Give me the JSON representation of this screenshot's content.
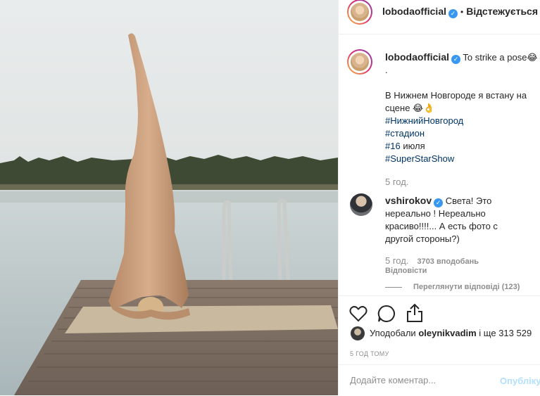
{
  "header": {
    "username": "lobodaofficial",
    "dot": "•",
    "follow_label": "Відстежується"
  },
  "caption": {
    "username": "lobodaofficial",
    "text_line1": "To strike a pose😂",
    "text_line2": ".",
    "body": "В Нижнем Новгороде я встану на сцене 😂👌",
    "hashtags": [
      "#НижнийНовгород",
      "#стадион"
    ],
    "date_hash": "#16",
    "date_rest": " июля",
    "hashtag_last": "#SuperStarShow",
    "time": "5 год."
  },
  "comment": {
    "username": "vshirokov",
    "text": "Света! Это нереально ! Нереально красиво!!!!... А есть фото с другой стороны?)",
    "time": "5 год.",
    "likes": "3703 вподобань",
    "reply_label": "Відповісти",
    "view_replies": "Переглянути відповіді (123)"
  },
  "likes": {
    "prefix": "Уподобали ",
    "user": "oleynikvadim",
    "suffix": " і ще 313 529"
  },
  "time_ago": "5 ГОД ТОМУ",
  "add_comment": {
    "placeholder": "Додайте коментар...",
    "publish_label": "Опублікувати"
  },
  "colors": {
    "link": "#003569",
    "muted": "#8e8e8e",
    "verified": "#3897f0",
    "publish_disabled": "#b2dffc"
  }
}
